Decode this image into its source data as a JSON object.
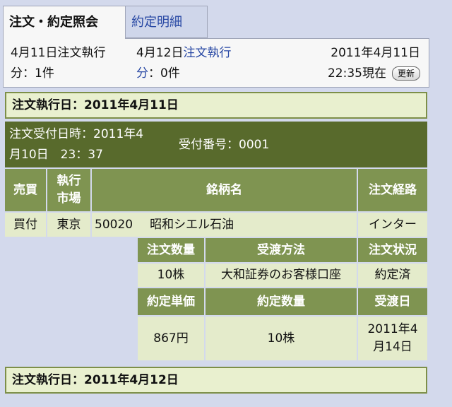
{
  "tabs": {
    "inquiry": "注文・約定照会",
    "details": "約定明細"
  },
  "status": {
    "apr11_line1": "4月11日注文執行",
    "apr11_line2": "分：1件",
    "apr12_line1a": "4月12日",
    "apr12_line1b": "注文執行",
    "apr12_line2a": "分",
    "apr12_line2b": "：0件",
    "as_of_date": "2011年4月11日",
    "as_of_time": "22:35現在",
    "refresh_label": "更新"
  },
  "exec_day_1": "注文執行日：2011年4月11日",
  "exec_day_2": "注文執行日：2011年4月12日",
  "order": {
    "received_line1": "注文受付日時：2011年4",
    "received_line2": "月10日　23：37",
    "receipt_number": "受付番号：0001",
    "headers": {
      "side": "売買",
      "market": "執行\n市場",
      "security": "銘柄名",
      "route": "注文経路",
      "quantity": "注文数量",
      "delivery_method": "受渡方法",
      "status": "注文状況",
      "exec_price": "約定単価",
      "exec_quantity": "約定数量",
      "delivery_date": "受渡日"
    },
    "values": {
      "side": "買付",
      "market": "東京",
      "code": "50020",
      "security_name": "昭和シエル石油",
      "route": "インター",
      "quantity": "10株",
      "delivery_method": "大和証券のお客様口座",
      "status": "約定済",
      "exec_price": "867円",
      "exec_quantity": "10株",
      "delivery_date": "2011年4\n月14日"
    }
  },
  "colors": {
    "page_bg": "#d3d9ec",
    "header_green": "#7f9451",
    "order_bar": "#586a2c",
    "value_bg": "#e4ebcb",
    "date_header_bg": "#e9f0cf",
    "link": "#2848a4"
  }
}
